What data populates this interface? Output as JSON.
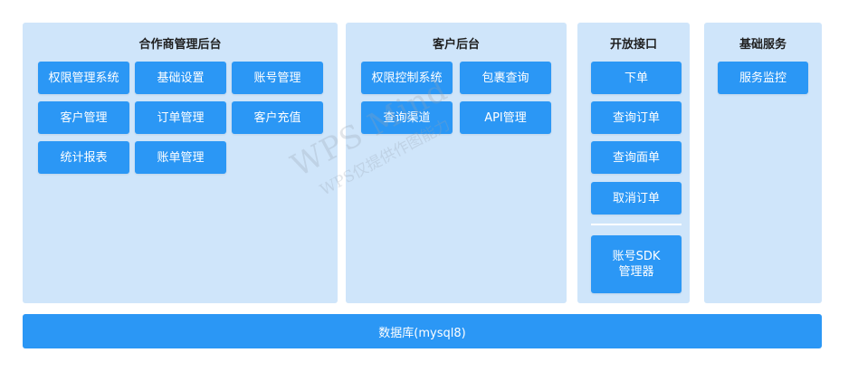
{
  "panels": {
    "partner": {
      "title": "合作商管理后台",
      "buttons": [
        "权限管理系统",
        "基础设置",
        "账号管理",
        "客户管理",
        "订单管理",
        "客户充值",
        "统计报表",
        "账单管理"
      ]
    },
    "customer": {
      "title": "客户后台",
      "buttons": [
        "权限控制系统",
        "包裹查询",
        "查询渠道",
        "API管理"
      ]
    },
    "open_api": {
      "title": "开放接口",
      "buttons": [
        "下单",
        "查询订单",
        "查询面单",
        "取消订单"
      ],
      "sdk_line1": "账号SDK",
      "sdk_line2": "管理器"
    },
    "base": {
      "title": "基础服务",
      "buttons": [
        "服务监控"
      ]
    }
  },
  "database": {
    "label": "数据库(mysql8)"
  },
  "watermark": {
    "main": "WPS Mind",
    "sub": "WPS仅提供作图能力"
  },
  "colors": {
    "panel_bg": "#cfe5fa",
    "button_bg": "#2b97f5",
    "button_text": "#ffffff",
    "title_text": "#1f1f1f"
  }
}
